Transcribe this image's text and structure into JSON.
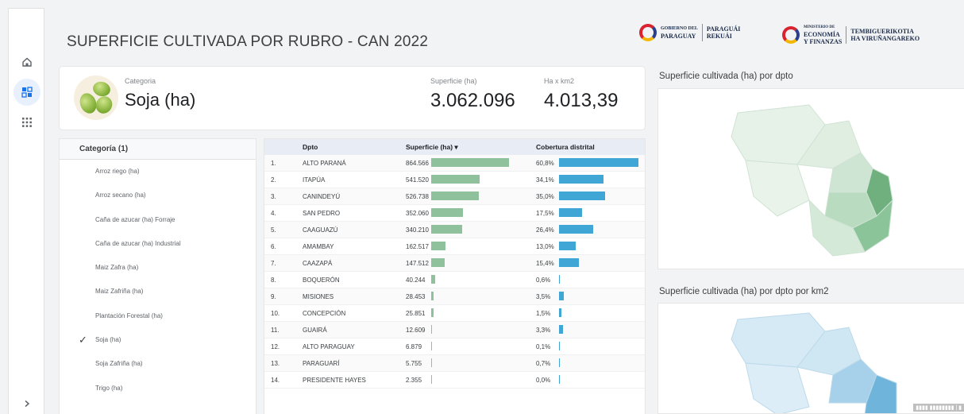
{
  "header": {
    "title": "SUPERFICIE CULTIVADA POR RUBRO - CAN 2022",
    "logo1": [
      "GOBIERNO DEL",
      "PARAGUAY",
      "PARAGUÁI",
      "REKUÁI"
    ],
    "logo2": [
      "MINISTERIO DE",
      "ECONOMÍA",
      "Y FINANZAS",
      "TEMBIGUERIKOTIA",
      "HA VIRUÑANGAREKO"
    ]
  },
  "kpi": {
    "category_label": "Categoria",
    "category_value": "Soja (ha)",
    "superficie_label": "Superficie (ha)",
    "superficie_value": "3.062.096",
    "ha_km2_label": "Ha x km2",
    "ha_km2_value": "4.013,39"
  },
  "category_list": {
    "header": "Categoría (1)",
    "items": [
      {
        "label": "Arroz riego (ha)",
        "checked": false
      },
      {
        "label": "Arroz secano (ha)",
        "checked": false
      },
      {
        "label": "Caña de azucar (ha) Forraje",
        "checked": false
      },
      {
        "label": "Caña de azucar (ha) Industrial",
        "checked": false
      },
      {
        "label": "Maiz Zafra (ha)",
        "checked": false
      },
      {
        "label": "Maiz Zafriña (ha)",
        "checked": false
      },
      {
        "label": "Plantación Forestal (ha)",
        "checked": false
      },
      {
        "label": "Soja (ha)",
        "checked": true
      },
      {
        "label": "Soja Zafriña (ha)",
        "checked": false
      },
      {
        "label": "Trigo (ha)",
        "checked": false
      }
    ]
  },
  "table": {
    "columns": [
      "Dpto",
      "Superficie (ha) ▾",
      "Cobertura distrital"
    ],
    "rows": [
      {
        "idx": "1.",
        "dpto": "ALTO PARANÁ",
        "sup": "864.566",
        "sup_frac": 1.0,
        "cob": "60,8%",
        "cob_frac": 1.0
      },
      {
        "idx": "2.",
        "dpto": "ITAPÚA",
        "sup": "541.520",
        "sup_frac": 0.626,
        "cob": "34,1%",
        "cob_frac": 0.561
      },
      {
        "idx": "3.",
        "dpto": "CANINDEYÚ",
        "sup": "526.738",
        "sup_frac": 0.609,
        "cob": "35,0%",
        "cob_frac": 0.576
      },
      {
        "idx": "4.",
        "dpto": "SAN PEDRO",
        "sup": "352.060",
        "sup_frac": 0.407,
        "cob": "17,5%",
        "cob_frac": 0.288
      },
      {
        "idx": "5.",
        "dpto": "CAAGUAZÚ",
        "sup": "340.210",
        "sup_frac": 0.394,
        "cob": "26,4%",
        "cob_frac": 0.434
      },
      {
        "idx": "6.",
        "dpto": "AMAMBAY",
        "sup": "162.517",
        "sup_frac": 0.188,
        "cob": "13,0%",
        "cob_frac": 0.214
      },
      {
        "idx": "7.",
        "dpto": "CAAZAPÁ",
        "sup": "147.512",
        "sup_frac": 0.171,
        "cob": "15,4%",
        "cob_frac": 0.253
      },
      {
        "idx": "8.",
        "dpto": "BOQUERÓN",
        "sup": "40.244",
        "sup_frac": 0.047,
        "cob": "0,6%",
        "cob_frac": 0.01
      },
      {
        "idx": "9.",
        "dpto": "MISIONES",
        "sup": "28.453",
        "sup_frac": 0.033,
        "cob": "3,5%",
        "cob_frac": 0.058
      },
      {
        "idx": "10.",
        "dpto": "CONCEPCIÓN",
        "sup": "25.851",
        "sup_frac": 0.03,
        "cob": "1,5%",
        "cob_frac": 0.025
      },
      {
        "idx": "11.",
        "dpto": "GUAIRÁ",
        "sup": "12.609",
        "sup_frac": 0.015,
        "cob": "3,3%",
        "cob_frac": 0.054
      },
      {
        "idx": "12.",
        "dpto": "ALTO PARAGUAY",
        "sup": "6.879",
        "sup_frac": 0.008,
        "cob": "0,1%",
        "cob_frac": 0.002
      },
      {
        "idx": "13.",
        "dpto": "PARAGUARÍ",
        "sup": "5.755",
        "sup_frac": 0.007,
        "cob": "0,7%",
        "cob_frac": 0.012
      },
      {
        "idx": "14.",
        "dpto": "PRESIDENTE HAYES",
        "sup": "2.355",
        "sup_frac": 0.003,
        "cob": "0,0%",
        "cob_frac": 0.0
      }
    ]
  },
  "maps": {
    "map1_title": "Superficie cultivada (ha) por dpto",
    "map2_title": "Superficie cultivada (ha) por dpto por km2",
    "map1_base_color": "#e6f1e7",
    "map1_dark_color": "#5fa56f",
    "map2_base_color": "#d6eaf5",
    "map2_dark_color": "#5aa9cf"
  },
  "colors": {
    "bar_superficie": "#8fc19c",
    "bar_cobertura": "#3fa6d6",
    "accent": "#1a73e8"
  },
  "nav": {
    "home_icon": "home-icon",
    "dashboard_icon": "dashboard-icon",
    "apps_icon": "apps-grid-icon",
    "expand_icon": "chevron-right-icon"
  }
}
